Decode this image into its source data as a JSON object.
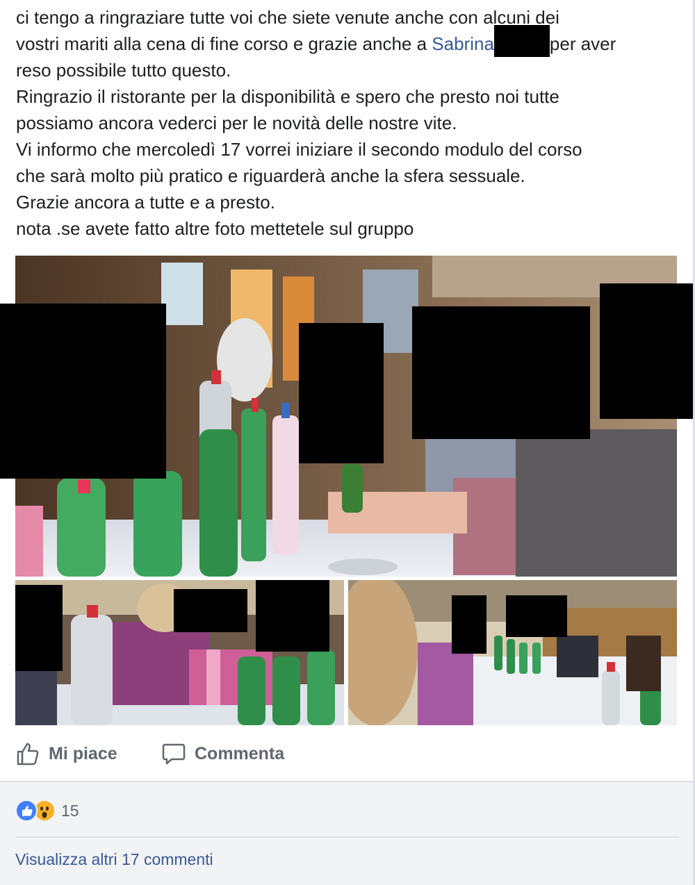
{
  "post": {
    "lines": [
      "ci tengo a ringraziare tutte voi che siete venute anche con alcuni dei",
      "reso possibile tutto questo.",
      "Ringrazio il ristorante per la disponibilità e spero che presto noi tutte",
      "possiamo ancora vederci per le novità delle nostre vite.",
      "Vi informo che mercoledì 17 vorrei iniziare il secondo modulo del corso",
      "che sarà molto più pratico e riguarderà anche la sfera sessuale.",
      "Grazie ancora a tutte e a presto.",
      "nota .se avete fatto altre foto mettetele sul gruppo"
    ],
    "line2_before": "vostri mariti alla cena di fine corso e grazie anche a ",
    "mention": "Sabrina",
    "line2_after": "per aver"
  },
  "actions": {
    "like_label": "Mi piace",
    "comment_label": "Commenta"
  },
  "footer": {
    "reaction_count": "15",
    "reactions": [
      "like-icon",
      "wow-icon"
    ],
    "more_comments": "Visualizza altri 17 commenti"
  },
  "colors": {
    "link": "#385898",
    "action_text": "#606770",
    "footer_bg": "#f2f3f5",
    "like_blue": "#4080ff",
    "wow_yellow": "#f7b125"
  }
}
